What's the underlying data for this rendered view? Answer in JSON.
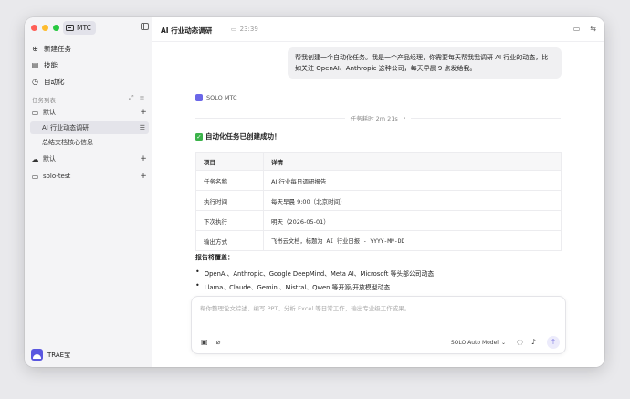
{
  "sidebar": {
    "brand": "MTC",
    "nav": [
      {
        "label": "新建任务",
        "icon": "plus-circle-icon"
      },
      {
        "label": "技能",
        "icon": "book-icon"
      },
      {
        "label": "自动化",
        "icon": "clock-icon"
      }
    ],
    "section_title": "任务列表",
    "folders": [
      {
        "label": "默认",
        "icon": "folder-icon"
      },
      {
        "label": "默认",
        "icon": "cloud-icon"
      },
      {
        "label": "solo-test",
        "icon": "folder-icon"
      }
    ],
    "tasks": [
      {
        "label": "AI 行业动态调研",
        "active": true
      },
      {
        "label": "总结文档核心信息",
        "active": false
      }
    ],
    "user": "TRAE宝"
  },
  "main": {
    "title": "AI 行业动态调研",
    "time": "23:39",
    "user_message": "帮我创建一个自动化任务。我是一个产品经理，你需要每天帮我我调研 AI 行业的动态，比如关注 OpenAI、Anthropic 这种公司，每天早晨 9 点发给我。",
    "agent_name": "SOLO MTC",
    "elapsed": "任务耗时 2m 21s",
    "success_text": "自动化任务已创建成功！",
    "table": {
      "headers": [
        "项目",
        "详情"
      ],
      "rows": [
        [
          "任务名称",
          "AI 行业每日调研报告"
        ],
        [
          "执行时间",
          "每天早晨 9:00（北京时间）"
        ],
        [
          "下次执行",
          "明天（2026-05-01）"
        ],
        [
          "输出方式",
          "飞书云文档，标题为 AI 行业日报 - YYYY-MM-DD"
        ]
      ]
    },
    "cover_title": "报告将覆盖：",
    "bullets": [
      "OpenAI、Anthropic、Google DeepMind、Meta AI、Microsoft 等头部公司动态",
      "Llama、Claude、Gemini、Mistral、Qwen 等开源/开放模型动态"
    ]
  },
  "composer": {
    "placeholder": "帮你整理论文综述、编写 PPT、分析 Excel 等日常工作，输出专业级工作成果。",
    "model": "SOLO Auto Model"
  }
}
